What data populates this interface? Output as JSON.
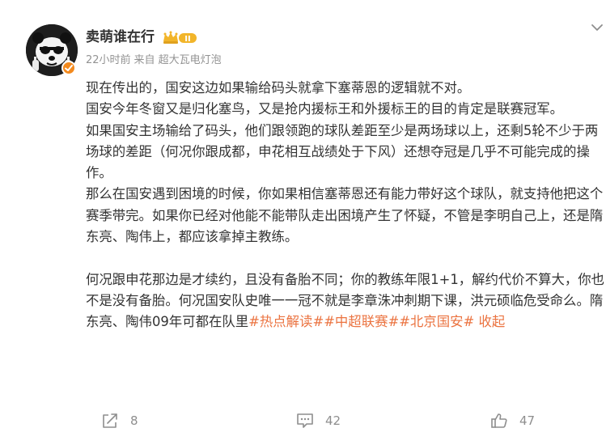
{
  "post": {
    "author": {
      "name": "卖萌谁在行",
      "avatar_icon": "panda-avatar-icon",
      "verified_icon": "verified-badge-icon",
      "level_badge": {
        "icon": "crown-level-icon",
        "level": "II",
        "color": "#f2b52a"
      }
    },
    "meta": {
      "time": "22小时前",
      "source_prefix": "来自",
      "source": "超大瓦电灯泡"
    },
    "more_icon": "chevron-down-icon",
    "paragraphs": [
      {
        "text": "现在传出的，国安这边如果输给码头就拿下塞蒂恩的逻辑就不对。"
      },
      {
        "text": "国安今年冬窗又是归化塞鸟，又是抢内援标王和外援标王的目的肯定是联赛冠军。"
      },
      {
        "text": "如果国安主场输给了码头，他们跟领跑的球队差距至少是两场球以上，还剩5轮不少于两场球的差距（何况你跟成都，申花相互战绩处于下风）还想夺冠是几乎不可能完成的操作。"
      },
      {
        "text": "那么在国安遇到困境的时候，你如果相信塞蒂恩还有能力带好这个球队，就支持他把这个赛季带完。如果你已经对他能不能带队走出困境产生了怀疑，不管是李明自己上，还是隋东亮、陶伟上，都应该拿掉主教练。"
      },
      {
        "text": "何况跟申花那边是才续约，且没有备胎不同；你的教练年限1+1，解约代价不算大，你也不是没有备胎。何况国安队史唯一一冠不就是李章洙冲刺期下课，洪元硕临危受命么。隋东亮、陶伟09年可都在队里"
      }
    ],
    "topics": [
      "#热点解读#",
      "#中超联赛#",
      "#北京国安#"
    ],
    "collapse_label": "收起",
    "collapse_prefix": " ",
    "actions": {
      "share": {
        "icon": "share-icon",
        "count": "8"
      },
      "comment": {
        "icon": "comment-icon",
        "count": "42"
      },
      "like": {
        "icon": "thumbs-up-icon",
        "count": "47"
      }
    },
    "colors": {
      "text": "#333333",
      "meta": "#939393",
      "topic": "#eb7340",
      "action": "#8e8e8e",
      "verified": "#f38a1e"
    }
  }
}
